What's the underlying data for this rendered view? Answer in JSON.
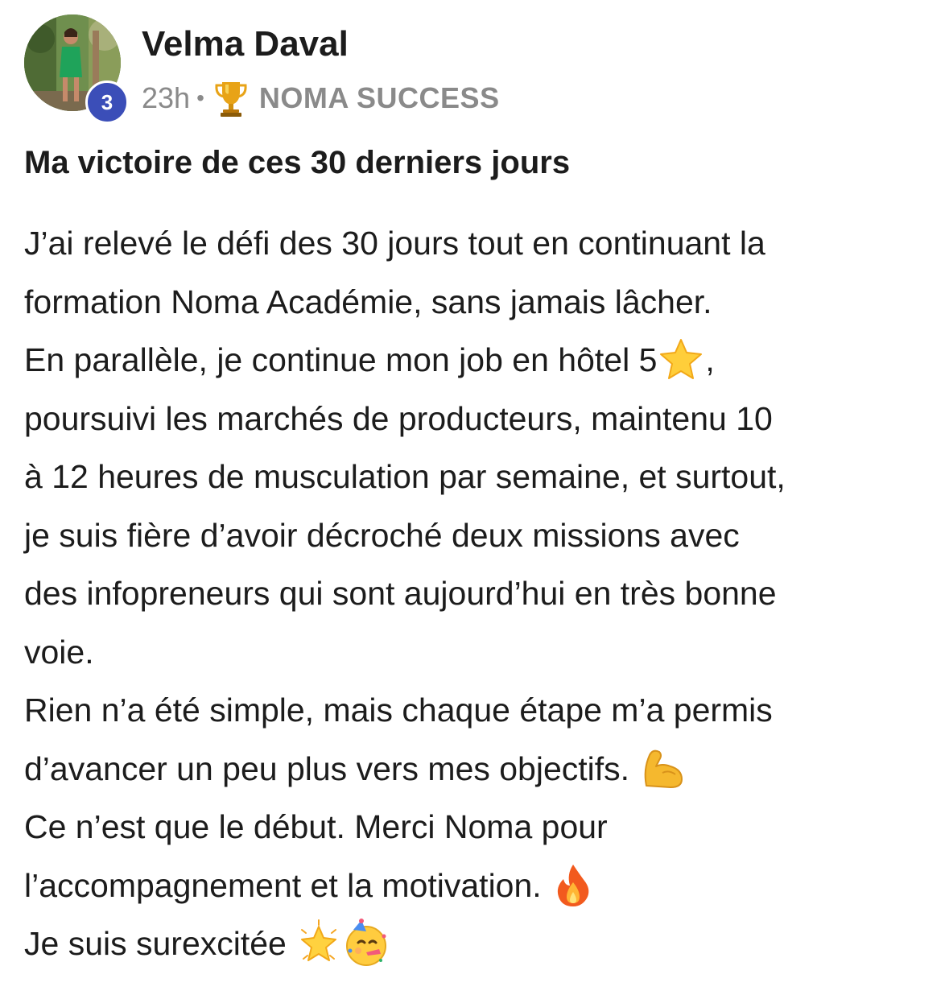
{
  "author": {
    "name": "Velma Daval",
    "level": "3",
    "avatar_icon": "profile-photo"
  },
  "meta": {
    "time": "23h",
    "separator": "•",
    "category_icon": "trophy-icon",
    "category": "NOMA SUCCESS"
  },
  "post": {
    "title": "Ma victoire de ces 30 derniers jours",
    "lines": [
      "J’ai relevé le défi des 30 jours tout en continuant la",
      "formation Noma Académie, sans jamais lâcher.",
      "En parallèle, je continue mon job en hôtel 5",
      "poursuivi les marchés de producteurs, maintenu 10",
      "à 12 heures de musculation par semaine, et surtout,",
      "je suis fière d’avoir décroché deux missions avec",
      "des infopreneurs qui sont aujourd’hui en très bonne",
      "voie.",
      "Rien n’a été simple, mais chaque étape m’a permis",
      "d’avancer un peu plus vers mes objectifs.",
      "Ce n’est que le début. Merci Noma pour",
      "l’accompagnement et la motivation.",
      "Je suis surexcitée"
    ],
    "line3_suffix": ",",
    "emojis": {
      "line3": "star-emoji",
      "line10": "flexed-biceps-emoji",
      "line12": "fire-emoji",
      "line13": [
        "glowing-star-emoji",
        "partying-face-emoji"
      ]
    }
  }
}
